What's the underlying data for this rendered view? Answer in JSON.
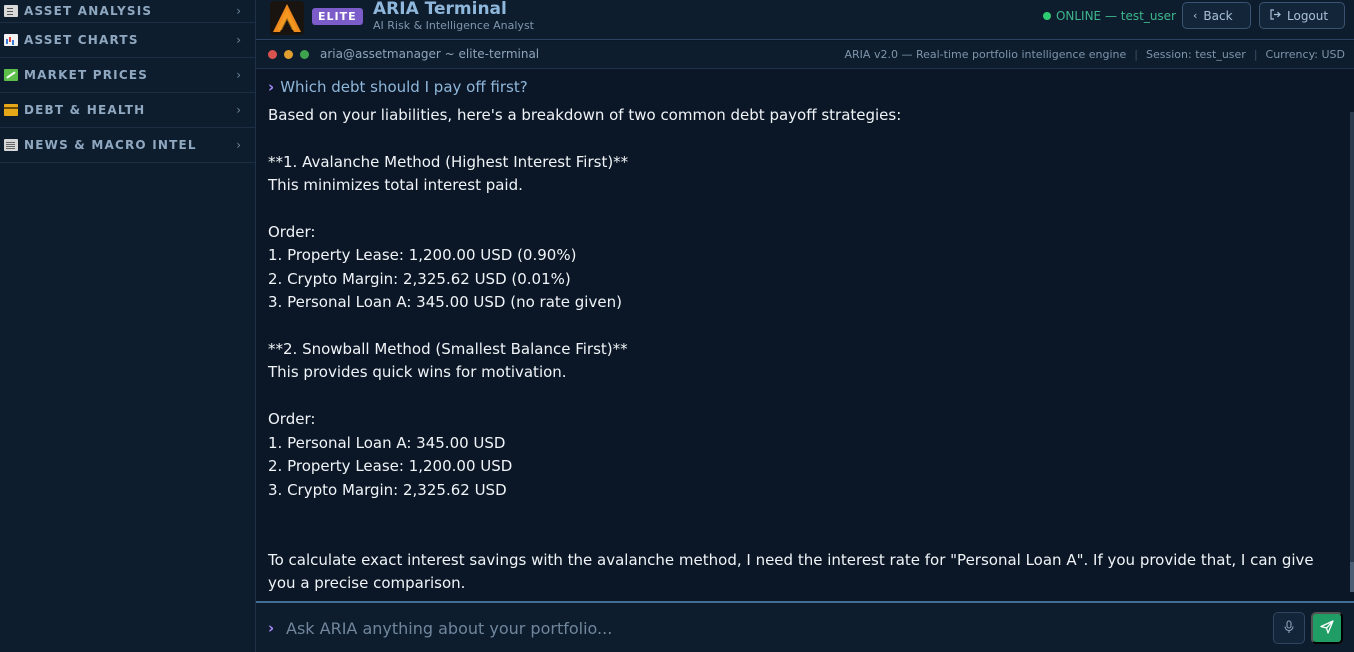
{
  "sidebar": {
    "items": [
      {
        "label": "ASSET ANALYSIS",
        "icon": "clipboard-icon"
      },
      {
        "label": "ASSET CHARTS",
        "icon": "bar-chart-icon"
      },
      {
        "label": "MARKET PRICES",
        "icon": "trend-chart-icon"
      },
      {
        "label": "DEBT & HEALTH",
        "icon": "credit-card-icon"
      },
      {
        "label": "NEWS & MACRO INTEL",
        "icon": "newspaper-icon"
      }
    ]
  },
  "header": {
    "badge": "ELITE",
    "title": "ARIA Terminal",
    "subtitle": "AI Risk & Intelligence Analyst",
    "status": "ONLINE — test_user",
    "back_label": "Back",
    "logout_label": "Logout"
  },
  "terminal": {
    "path": "aria@assetmanager ~ elite-terminal",
    "version": "ARIA v2.0 — Real-time portfolio intelligence engine",
    "session": "Session: test_user",
    "currency": "Currency: USD"
  },
  "chat": {
    "question": "Which debt should I pay off first?",
    "answer": "Based on your liabilities, here's a breakdown of two common debt payoff strategies:\n\n**1. Avalanche Method (Highest Interest First)**\nThis minimizes total interest paid.\n\nOrder:\n1. Property Lease: 1,200.00 USD (0.90%)\n2. Crypto Margin: 2,325.62 USD (0.01%)\n3. Personal Loan A: 345.00 USD (no rate given)\n\n**2. Snowball Method (Smallest Balance First)**\nThis provides quick wins for motivation.\n\nOrder:\n1. Personal Loan A: 345.00 USD\n2. Property Lease: 1,200.00 USD\n3. Crypto Margin: 2,325.62 USD\n\n\nTo calculate exact interest savings with the avalanche method, I need the interest rate for \"Personal Loan A\". If you provide that, I can give you a precise comparison."
  },
  "input": {
    "placeholder": "Ask ARIA anything about your portfolio..."
  },
  "colors": {
    "accent": "#a78bfa",
    "online": "#2ecc71",
    "send": "#1f9d65",
    "elite_badge": "#7b5cc9"
  }
}
